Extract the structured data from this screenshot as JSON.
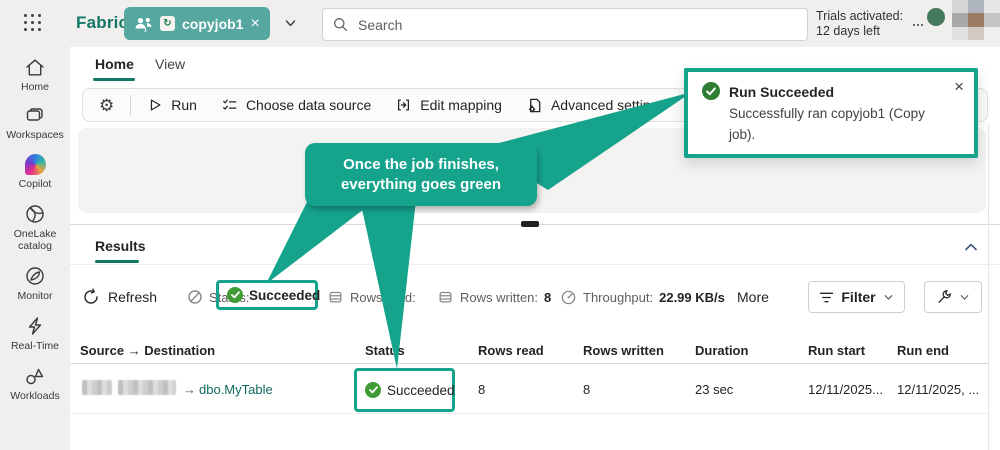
{
  "topbar": {
    "brand": "Fabric",
    "workspace_tab": "copyjob1",
    "people_badge_count": "1",
    "close_glyph": "×",
    "search_placeholder": "Search",
    "trials_line1": "Trials activated:",
    "trials_line2": "12 days left"
  },
  "sidebar": {
    "items": [
      {
        "label": "Home"
      },
      {
        "label": "Workspaces"
      },
      {
        "label": "Copilot"
      },
      {
        "label": "OneLake catalog"
      },
      {
        "label": "Monitor"
      },
      {
        "label": "Real-Time"
      },
      {
        "label": "Workloads"
      }
    ]
  },
  "ribbon_tabs": {
    "home": "Home",
    "view": "View"
  },
  "toolbar": {
    "run": "Run",
    "choose_data_source": "Choose data source",
    "edit_mapping": "Edit mapping",
    "advanced_settings": "Advanced settings"
  },
  "notification": {
    "title": "Run Succeeded",
    "message": "Successfully ran copyjob1 (Copy job).",
    "close_glyph": "×"
  },
  "callout": {
    "line1": "Once the job finishes,",
    "line2": "everything goes green"
  },
  "results": {
    "title": "Results",
    "refresh_label": "Refresh",
    "stats": {
      "status_label": "Status:",
      "status_value": "Succeeded",
      "rows_read_label": "Rows read:",
      "rows_written_label": "Rows written:",
      "rows_written_value": "8",
      "throughput_label": "Throughput:",
      "throughput_value": "22.99 KB/s",
      "more_label": "More"
    },
    "filter_label": "Filter",
    "table": {
      "headers": [
        "Source → Destination",
        "Status",
        "Rows read",
        "Rows written",
        "Duration",
        "Run start",
        "Run end"
      ],
      "row": {
        "arrow": "→",
        "destination": "dbo.MyTable",
        "status": "Succeeded",
        "rows_read": "8",
        "rows_written": "8",
        "duration": "23 sec",
        "run_start": "12/11/2025...",
        "run_end": "12/11/2025, ..."
      }
    }
  },
  "colors": {
    "annotation_teal": "#16a38c",
    "brand_teal": "#117865",
    "success_green": "#3f9b35"
  }
}
